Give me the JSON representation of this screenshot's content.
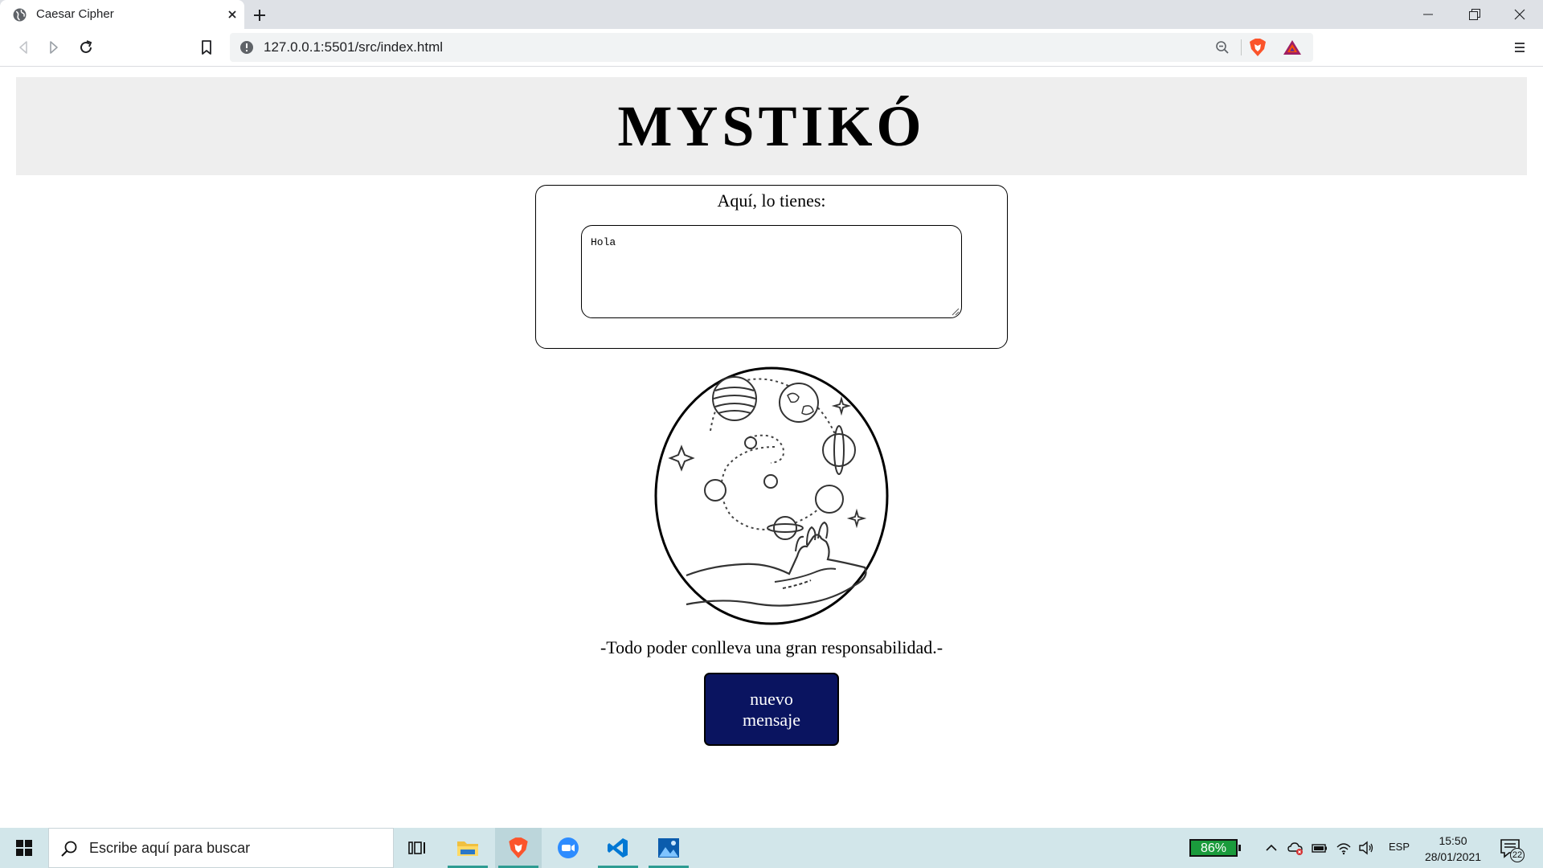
{
  "browser": {
    "tab_title": "Caesar Cipher",
    "url": "127.0.0.1:5501/src/index.html"
  },
  "page": {
    "title": "MYSTIKÓ",
    "result_label": "Aquí, lo tienes:",
    "result_text": "Hola",
    "quote": "-Todo poder conlleva una gran responsabilidad.-",
    "new_message_button": "nuevo mensaje"
  },
  "taskbar": {
    "search_placeholder": "Escribe aquí para buscar",
    "battery_percent": "86%",
    "language": "ESP",
    "time": "15:50",
    "date": "28/01/2021",
    "notification_count": "22",
    "apps": [
      "task-view",
      "file-explorer",
      "brave",
      "zoom",
      "vscode",
      "photos"
    ]
  },
  "colors": {
    "header_bg": "#eeeeee",
    "button_bg": "#0a1460",
    "taskbar_bg": "#d2e6ea",
    "battery_green": "#1a9b3c"
  }
}
